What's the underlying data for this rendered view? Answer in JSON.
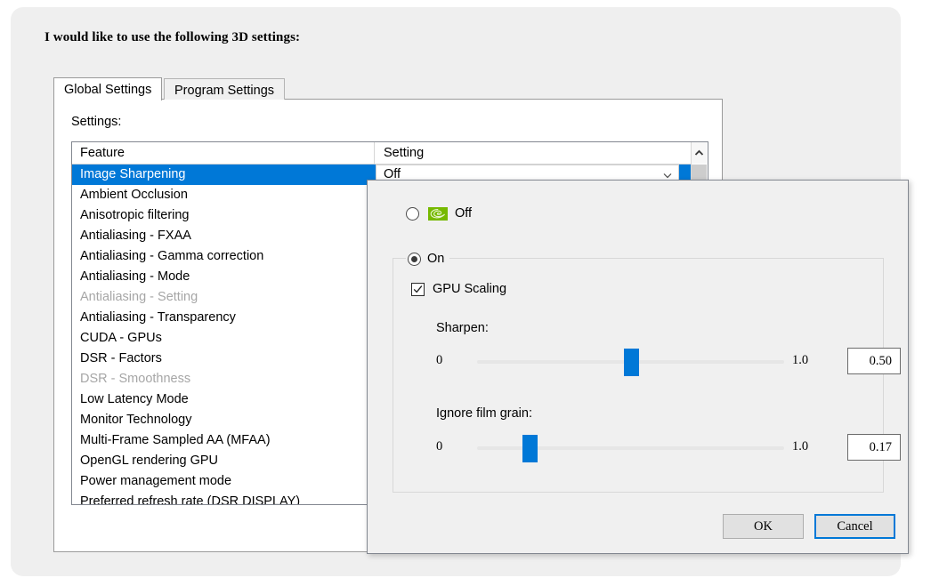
{
  "page": {
    "heading": "I would like to use the following 3D settings:"
  },
  "tabs": [
    {
      "label": "Global Settings",
      "active": true
    },
    {
      "label": "Program Settings",
      "active": false
    }
  ],
  "settings_panel": {
    "label": "Settings:",
    "columns": {
      "feature": "Feature",
      "setting": "Setting"
    },
    "selected_setting_value": "Off",
    "rows": [
      {
        "feature": "Image Sharpening",
        "selected": true,
        "dimmed": false
      },
      {
        "feature": "Ambient Occlusion",
        "selected": false,
        "dimmed": false
      },
      {
        "feature": "Anisotropic filtering",
        "selected": false,
        "dimmed": false
      },
      {
        "feature": "Antialiasing - FXAA",
        "selected": false,
        "dimmed": false
      },
      {
        "feature": "Antialiasing - Gamma correction",
        "selected": false,
        "dimmed": false
      },
      {
        "feature": "Antialiasing - Mode",
        "selected": false,
        "dimmed": false
      },
      {
        "feature": "Antialiasing - Setting",
        "selected": false,
        "dimmed": true
      },
      {
        "feature": "Antialiasing - Transparency",
        "selected": false,
        "dimmed": false
      },
      {
        "feature": "CUDA - GPUs",
        "selected": false,
        "dimmed": false
      },
      {
        "feature": "DSR - Factors",
        "selected": false,
        "dimmed": false
      },
      {
        "feature": "DSR - Smoothness",
        "selected": false,
        "dimmed": true
      },
      {
        "feature": "Low Latency Mode",
        "selected": false,
        "dimmed": false
      },
      {
        "feature": "Monitor Technology",
        "selected": false,
        "dimmed": false
      },
      {
        "feature": "Multi-Frame Sampled AA (MFAA)",
        "selected": false,
        "dimmed": false
      },
      {
        "feature": "OpenGL rendering GPU",
        "selected": false,
        "dimmed": false
      },
      {
        "feature": "Power management mode",
        "selected": false,
        "dimmed": false
      },
      {
        "feature": "Preferred refresh rate (DSR DISPLAY)",
        "selected": false,
        "dimmed": false
      }
    ]
  },
  "dialog": {
    "option_off": {
      "label": "Off",
      "checked": false
    },
    "option_on": {
      "label": "On",
      "checked": true
    },
    "gpu_scaling": {
      "label": "GPU Scaling",
      "checked": true
    },
    "sharpen": {
      "label": "Sharpen:",
      "min_label": "0",
      "max_label": "1.0",
      "value": "0.50",
      "percent": 50
    },
    "film_grain": {
      "label": "Ignore film grain:",
      "min_label": "0",
      "max_label": "1.0",
      "value": "0.17",
      "percent": 17
    },
    "buttons": {
      "ok": "OK",
      "cancel": "Cancel"
    }
  },
  "colors": {
    "accent": "#0078d7",
    "nvidia_green": "#76b900",
    "selection": "#0078d7"
  }
}
